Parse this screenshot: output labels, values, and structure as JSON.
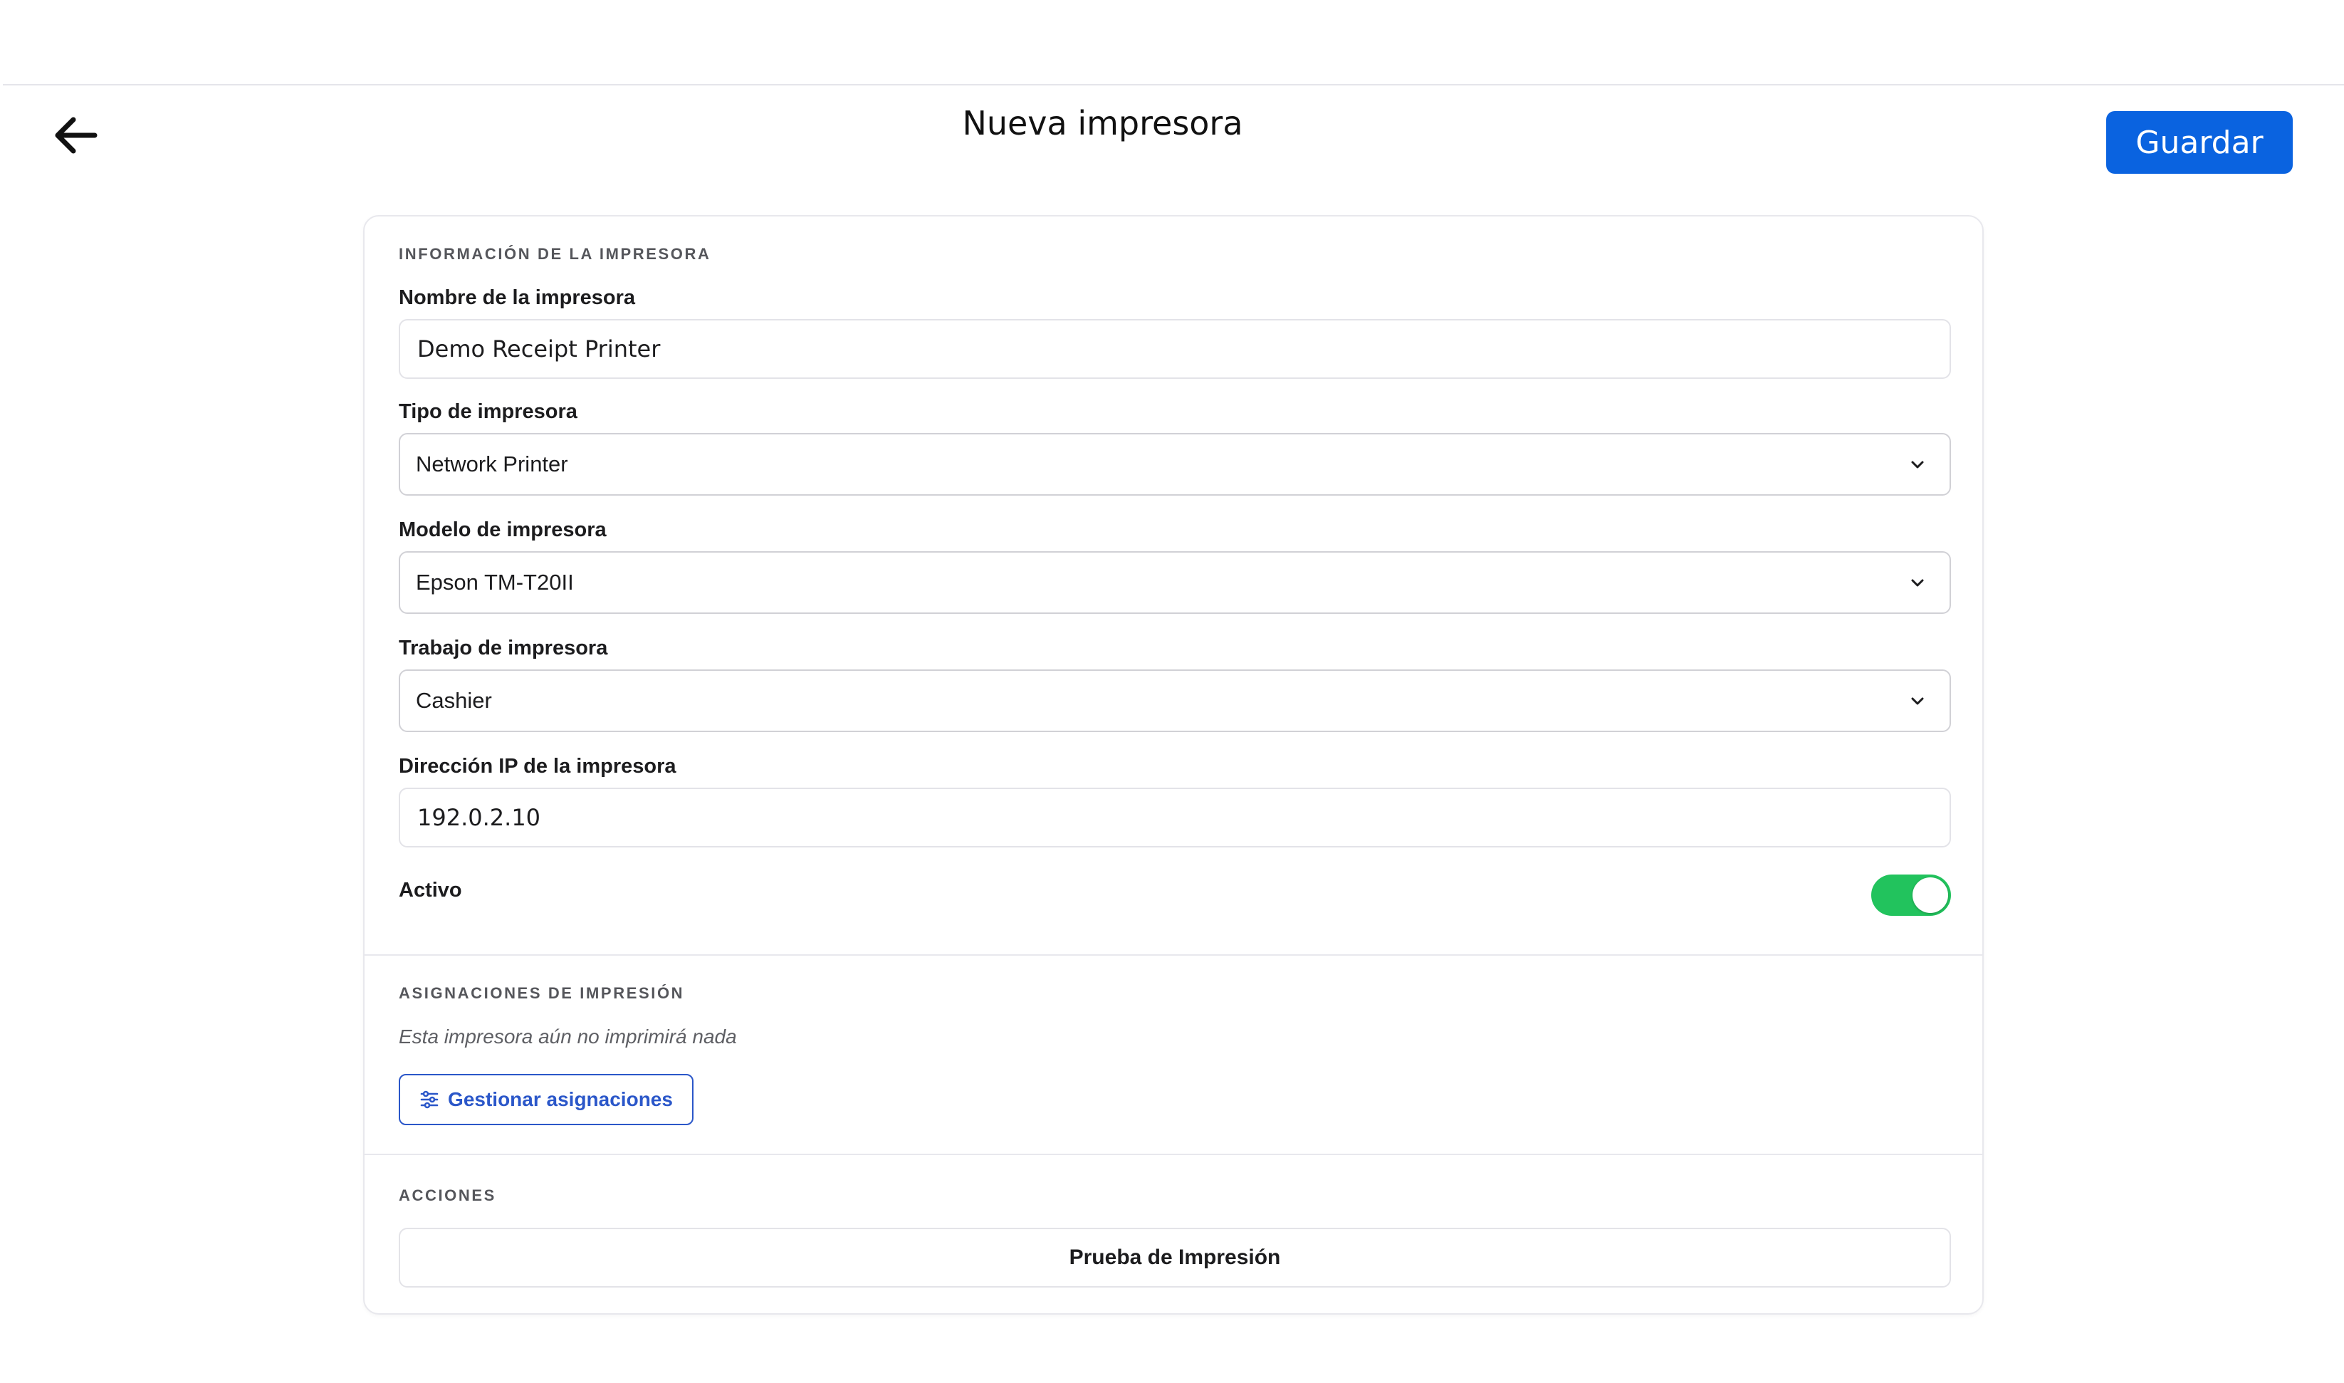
{
  "header": {
    "title": "Nueva impresora",
    "save_label": "Guardar",
    "back_icon": "arrow-left-icon"
  },
  "printer_info": {
    "section_label": "INFORMACIÓN DE LA IMPRESORA",
    "name": {
      "label": "Nombre de la impresora",
      "value": "Demo Receipt Printer"
    },
    "type": {
      "label": "Tipo de impresora",
      "value": "Network Printer"
    },
    "model": {
      "label": "Modelo de impresora",
      "value": "Epson TM-T20II"
    },
    "job": {
      "label": "Trabajo de impresora",
      "value": "Cashier"
    },
    "ip": {
      "label": "Dirección IP de la impresora",
      "value": "192.0.2.10"
    },
    "active": {
      "label": "Activo",
      "enabled": true
    }
  },
  "assignments": {
    "section_label": "ASIGNACIONES DE IMPRESIÓN",
    "note": "Esta impresora aún no imprimirá nada",
    "manage_label": "Gestionar asignaciones"
  },
  "actions": {
    "section_label": "ACCIONES",
    "test_print_label": "Prueba de Impresión"
  },
  "colors": {
    "primary": "#0a63e0",
    "toggle_on": "#22c35d",
    "outline_button": "#2b57c9"
  }
}
